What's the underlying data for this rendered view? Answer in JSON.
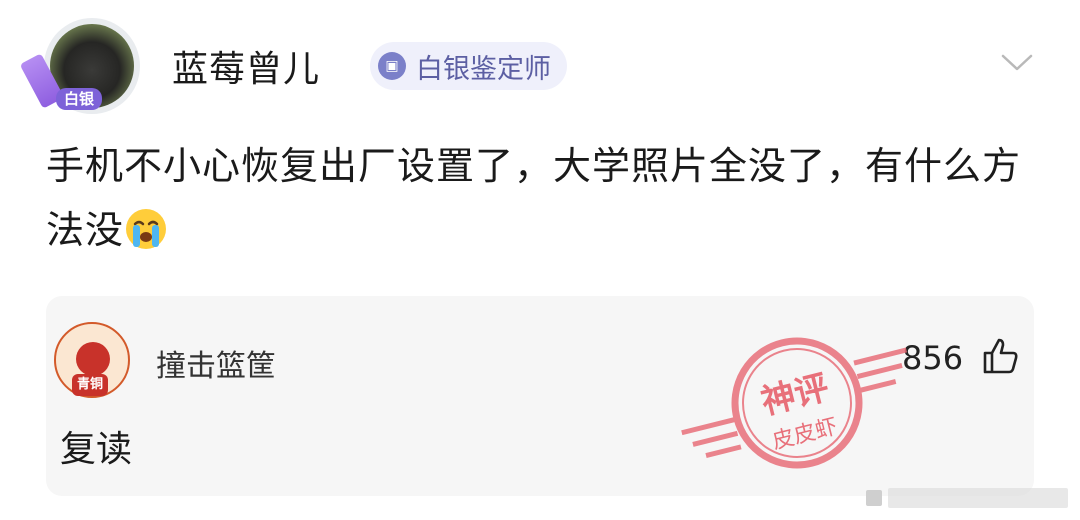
{
  "post": {
    "author": {
      "name": "蓝莓曾儿",
      "avatar_badge": "白银",
      "rank_tag": "白银鉴定师"
    },
    "text": "手机不小心恢复出厂设置了，大学照片全没了，有什么方法没",
    "emoji": "crying-face",
    "expand_icon": "chevron-down-icon"
  },
  "top_comment": {
    "user": "撞击篮筐",
    "avatar_badge": "青铜",
    "likes": "856",
    "text": "复读",
    "stamp": {
      "top": "神评",
      "bottom": "皮皮虾",
      "color": "#e8707a"
    }
  },
  "colors": {
    "tag_bg": "#eff0fb",
    "tag_text": "#5c5fa3",
    "comment_bg": "#f6f6f6"
  }
}
